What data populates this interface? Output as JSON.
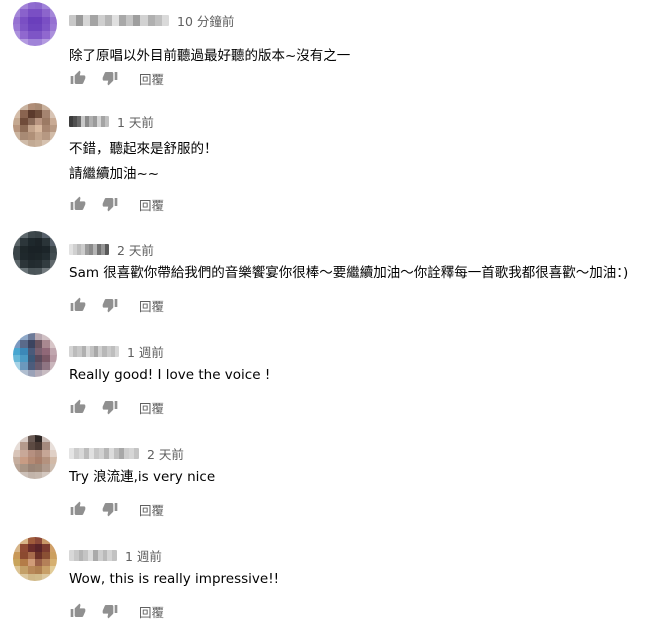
{
  "comments": [
    {
      "time": "10 分鐘前",
      "lines": [
        "除了原唱以外目前聽過最好聽的版本~沒有之一"
      ],
      "reply_label": "回覆",
      "avatar_colors": [
        "#b8a0e0",
        "#a383d8",
        "#8f6bd0",
        "#8c68cd",
        "#9f82d9",
        "#bba6e3",
        "#a487d9",
        "#8a62cc",
        "#7a4fc4",
        "#7a4fc4",
        "#8c65cc",
        "#a487d9",
        "#9571d1",
        "#7a4fc4",
        "#6a3fbc",
        "#6b3fbc",
        "#7a4fc4",
        "#9571d1",
        "#9a78d4",
        "#7e55c6",
        "#6e44be",
        "#6e44be",
        "#7e55c6",
        "#9a78d4",
        "#ab90dc",
        "#9068cf",
        "#7e55c6",
        "#7e55c6",
        "#9068cf",
        "#ab90dc",
        "#c7b6e8",
        "#b39ae0",
        "#a083d8",
        "#a083d8",
        "#b39ae0",
        "#c7b6e8"
      ],
      "name_colors": [
        "#c8c8c8",
        "#9a9a9a",
        "#d6d6d6",
        "#a4a4a4",
        "#cfcfcf",
        "#b6b6b6",
        "#e0e0e0",
        "#a8a8a8",
        "#c4c4c4",
        "#9e9e9e",
        "#d2d2d2",
        "#b0b0b0",
        "#c0c0c0",
        "#dadada"
      ]
    },
    {
      "time": "1 天前",
      "lines": [
        "不錯，聽起來是舒服的！",
        "請繼續加油~~"
      ],
      "reply_label": "回覆",
      "avatar_colors": [
        "#e8dcd0",
        "#c9b3a0",
        "#b08e78",
        "#a88a74",
        "#c8b09c",
        "#e6d8cc",
        "#d4bca8",
        "#8a6450",
        "#5c3a2c",
        "#6e4c3a",
        "#a58470",
        "#d8c4b4",
        "#c4a890",
        "#704c3a",
        "#8a6a58",
        "#b89480",
        "#9c7a64",
        "#c8aa94",
        "#b8967e",
        "#8e6c56",
        "#c2a28a",
        "#d8b89e",
        "#a88670",
        "#b89a84",
        "#cbb49f",
        "#a88a74",
        "#b09078",
        "#c4a68e",
        "#b69882",
        "#d2bca8",
        "#e8ddd2",
        "#cfbba8",
        "#c2aa94",
        "#c8b09a",
        "#d6c2b0",
        "#eae0d6"
      ],
      "name_colors": [
        "#3c3c3c",
        "#505050",
        "#6a6a6a",
        "#c8c8c8",
        "#8a8a8a",
        "#b0b0b0",
        "#9a9a9a",
        "#d4d4d4",
        "#a4a4a4",
        "#c0c0c0"
      ]
    },
    {
      "time": "2 天前",
      "lines": [
        "Sam 很喜歡你帶給我們的音樂饗宴你很棒～要繼續加油～你詮釋每一首歌我都很喜歡～加油：)"
      ],
      "reply_label": "回覆",
      "avatar_colors": [
        "#8a9296",
        "#5e686c",
        "#3e484c",
        "#3a4448",
        "#56606a",
        "#8c9498",
        "#5a6468",
        "#2c363a",
        "#1e282c",
        "#1c2428",
        "#2a3438",
        "#56606a",
        "#3a4448",
        "#1e272a",
        "#1a2226",
        "#1a2226",
        "#1c2529",
        "#3c464a",
        "#3a4448",
        "#1f282c",
        "#1c2428",
        "#1d2629",
        "#222c30",
        "#424c50",
        "#5a6468",
        "#2c3539",
        "#222b2f",
        "#242d31",
        "#323c40",
        "#60686c",
        "#9aa2a6",
        "#6a7478",
        "#4a5458",
        "#4c565a",
        "#727a7e",
        "#a4acb0"
      ],
      "name_colors": [
        "#e2e2e2",
        "#d0d0d0",
        "#bcbcbc",
        "#cccccc",
        "#9c9c9c",
        "#8a8a8a",
        "#b4b4b4",
        "#707070",
        "#969696",
        "#5a5a5a"
      ]
    },
    {
      "time": "1 週前",
      "lines": [
        "Really good! I love the voice !"
      ],
      "reply_label": "回覆",
      "avatar_colors": [
        "#c8d6e6",
        "#8ea8c8",
        "#6c7a98",
        "#b8a8b0",
        "#d0c0c4",
        "#e6dcdc",
        "#7a98c0",
        "#5a6a8a",
        "#3c4460",
        "#6a5460",
        "#a88890",
        "#d8c6c8",
        "#48a6d0",
        "#3c88b8",
        "#4a5a7a",
        "#7a6070",
        "#906878",
        "#c0a6ae",
        "#68b8d8",
        "#4c9ac4",
        "#3c5878",
        "#5a4a5c",
        "#7a5866",
        "#b89aa4",
        "#a6d2e6",
        "#6c98bc",
        "#4c5c7c",
        "#6a5a6c",
        "#8e7482",
        "#cab6bc",
        "#dce8f0",
        "#b0bed0",
        "#9aa2b8",
        "#b4aab6",
        "#c8bcc2",
        "#e6dfe2"
      ],
      "name_colors": [
        "#d4d4d4",
        "#bcbcbc",
        "#c8c8c8",
        "#b0b0b0",
        "#dadada",
        "#c2c2c2",
        "#a8a8a8",
        "#d0d0d0",
        "#b8b8b8",
        "#cacaca",
        "#bebebe",
        "#d6d6d6"
      ]
    },
    {
      "time": "2 天前",
      "lines": [
        "Try 浪流連,is very nice"
      ],
      "reply_label": "回覆",
      "avatar_colors": [
        "#f0ebe8",
        "#d8ccc6",
        "#6a5a54",
        "#2e2624",
        "#c8bab4",
        "#f2ede9",
        "#e6dcd6",
        "#b49a8c",
        "#5c4a42",
        "#4a3a34",
        "#a48a7e",
        "#e8dfda",
        "#d8c4b8",
        "#c8a898",
        "#b69080",
        "#a88474",
        "#c6a696",
        "#e0d0c6",
        "#c6ae9e",
        "#c89c84",
        "#b48a74",
        "#a87e6a",
        "#b4927e",
        "#d2baa8",
        "#b8a496",
        "#a89484",
        "#9a8476",
        "#9e8878",
        "#b09a8c",
        "#cdbdb0",
        "#e4dcd6",
        "#ccc0b8",
        "#c2b4aa",
        "#c6b8ae",
        "#d4c8c0",
        "#ece6e2"
      ],
      "name_colors": [
        "#e4e4e4",
        "#cccccc",
        "#d8d8d8",
        "#bcbcbc",
        "#e0e0e0",
        "#c6c6c6",
        "#d2d2d2",
        "#b6b6b6",
        "#dcdcdc",
        "#c0c0c0",
        "#a8a8a8",
        "#cecece",
        "#d6d6d6",
        "#c4c4c4"
      ]
    },
    {
      "time": "1 週前",
      "lines": [
        "Wow, this is really impressive!!"
      ],
      "reply_label": "回覆",
      "avatar_colors": [
        "#ece4d0",
        "#d8b488",
        "#a05c3c",
        "#8c4838",
        "#c89868",
        "#ead9b6",
        "#d6b488",
        "#904a34",
        "#6a2c2a",
        "#5a2428",
        "#7c3c30",
        "#d0a068",
        "#c89858",
        "#8c4a30",
        "#a86c4c",
        "#6c3228",
        "#8a5034",
        "#cca060",
        "#c8a45c",
        "#b47c48",
        "#d09c78",
        "#9a6048",
        "#b48058",
        "#d6b070",
        "#dcc494",
        "#c4a068",
        "#b88858",
        "#b08050",
        "#c8a068",
        "#e2cc98",
        "#f0e6d0",
        "#dcc8a0",
        "#d0b888",
        "#d2bc8c",
        "#dcc8a0",
        "#f0e6d2"
      ],
      "name_colors": [
        "#d8d8d8",
        "#c8c8c8",
        "#b4b4b4",
        "#c4c4c4",
        "#dcdcdc",
        "#aaaaaa",
        "#cecece",
        "#bababa",
        "#d4d4d4",
        "#c2c2c2"
      ]
    }
  ]
}
